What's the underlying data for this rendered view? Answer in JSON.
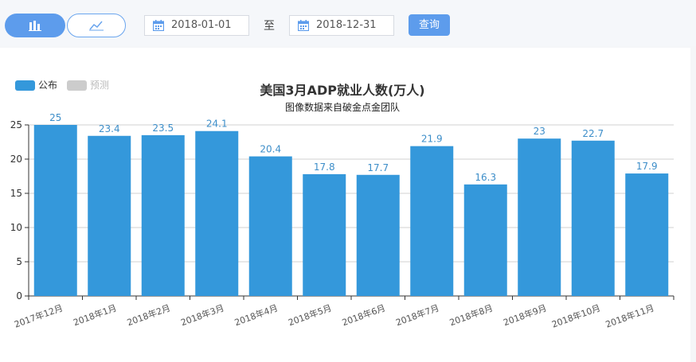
{
  "toolbar": {
    "start_date": "2018-01-01",
    "range_separator": "至",
    "end_date": "2018-12-31",
    "query_label": "查询"
  },
  "legend": [
    {
      "name": "公布",
      "color": "#3498db",
      "active": true
    },
    {
      "name": "预测",
      "color": "#cccccc",
      "active": false
    }
  ],
  "colors": {
    "accent": "#5d9cec",
    "bar": "#3498db",
    "label": "#3d8ec9"
  },
  "chart_data": {
    "type": "bar",
    "title": "美国3月ADP就业人数(万人)",
    "subtitle": "图像数据来自破金点金团队",
    "categories": [
      "2017年12月",
      "2018年1月",
      "2018年2月",
      "2018年3月",
      "2018年4月",
      "2018年5月",
      "2018年6月",
      "2018年7月",
      "2018年8月",
      "2018年9月",
      "2018年10月",
      "2018年11月"
    ],
    "series": [
      {
        "name": "公布",
        "values": [
          25,
          23.4,
          23.5,
          24.1,
          20.4,
          17.8,
          17.7,
          21.9,
          16.3,
          23,
          22.7,
          17.9
        ]
      }
    ],
    "yticks": [
      0,
      5,
      10,
      15,
      20,
      25
    ],
    "ylim": [
      0,
      25
    ],
    "grid": true,
    "legend_position": "top-left"
  }
}
